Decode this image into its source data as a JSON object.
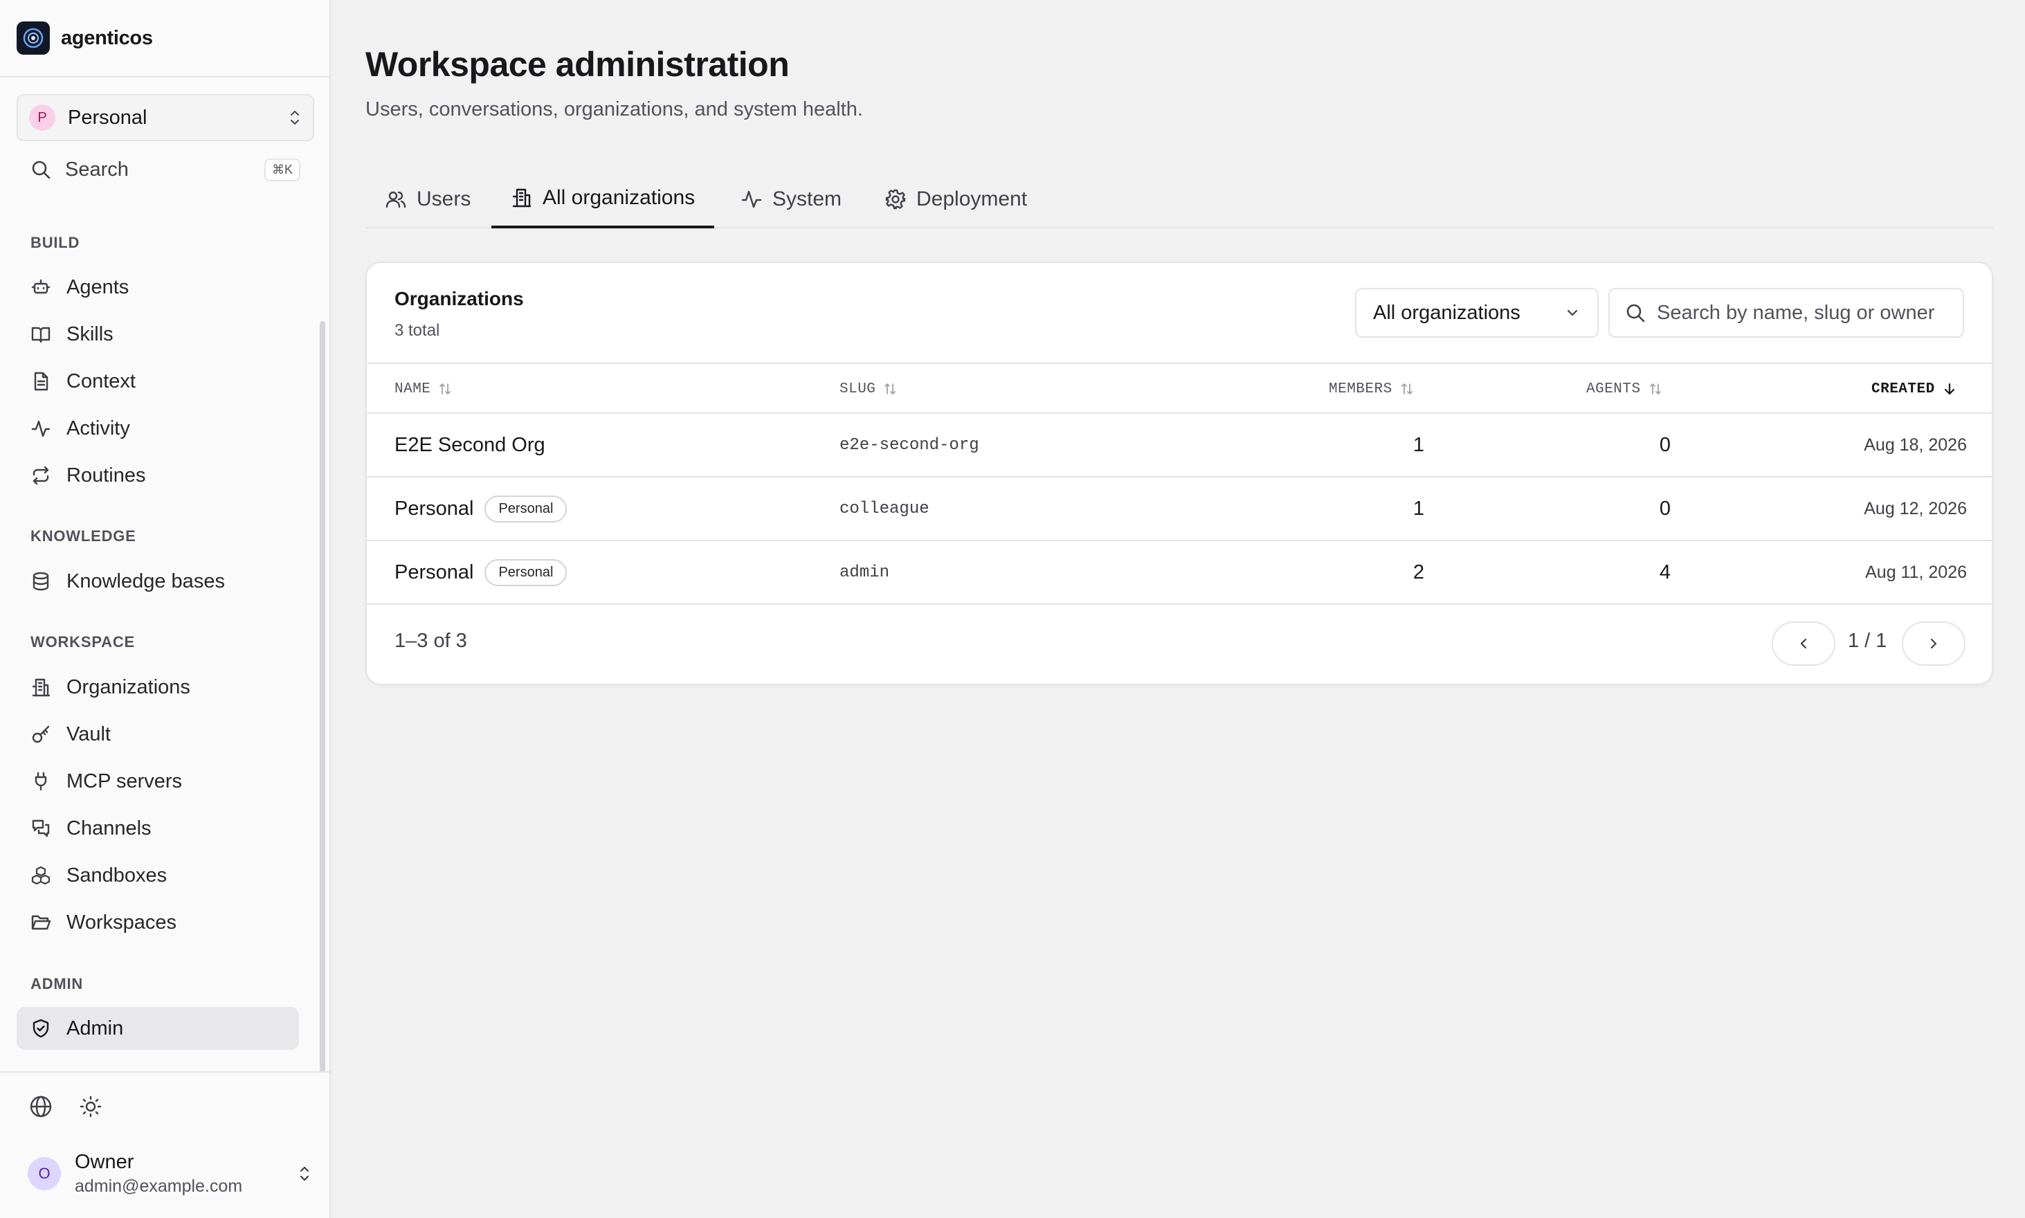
{
  "app": {
    "name": "agenticos"
  },
  "workspace": {
    "initial": "P",
    "name": "Personal"
  },
  "search": {
    "label": "Search",
    "shortcut": "⌘K"
  },
  "sidebar": {
    "sections": [
      {
        "title": "BUILD",
        "items": [
          {
            "label": "Agents",
            "icon": "robot-icon"
          },
          {
            "label": "Skills",
            "icon": "book-icon"
          },
          {
            "label": "Context",
            "icon": "document-icon"
          },
          {
            "label": "Activity",
            "icon": "activity-icon"
          },
          {
            "label": "Routines",
            "icon": "repeat-icon"
          }
        ]
      },
      {
        "title": "KNOWLEDGE",
        "items": [
          {
            "label": "Knowledge bases",
            "icon": "database-icon"
          }
        ]
      },
      {
        "title": "WORKSPACE",
        "items": [
          {
            "label": "Organizations",
            "icon": "building-icon"
          },
          {
            "label": "Vault",
            "icon": "key-icon"
          },
          {
            "label": "MCP servers",
            "icon": "plug-icon"
          },
          {
            "label": "Channels",
            "icon": "chat-icon"
          },
          {
            "label": "Sandboxes",
            "icon": "boxes-icon"
          },
          {
            "label": "Workspaces",
            "icon": "folder-icon"
          }
        ]
      },
      {
        "title": "ADMIN",
        "items": [
          {
            "label": "Admin",
            "icon": "shield-icon",
            "active": true
          }
        ]
      }
    ]
  },
  "user": {
    "initial": "O",
    "name": "Owner",
    "email": "admin@example.com"
  },
  "page": {
    "title": "Workspace administration",
    "subtitle": "Users, conversations, organizations, and system health."
  },
  "tabs": [
    {
      "label": "Users",
      "icon": "users-icon"
    },
    {
      "label": "All organizations",
      "icon": "building-icon",
      "active": true
    },
    {
      "label": "System",
      "icon": "activity-icon"
    },
    {
      "label": "Deployment",
      "icon": "gear-icon"
    }
  ],
  "orgs": {
    "title": "Organizations",
    "count": "3 total",
    "filter": "All organizations",
    "search_placeholder": "Search by name, slug or owner",
    "columns": {
      "name": "NAME",
      "slug": "SLUG",
      "members": "MEMBERS",
      "agents": "AGENTS",
      "created": "CREATED"
    },
    "rows": [
      {
        "name": "E2E Second Org",
        "badge": "",
        "slug": "e2e-second-org",
        "members": "1",
        "agents": "0",
        "created": "Aug 18, 2026"
      },
      {
        "name": "Personal",
        "badge": "Personal",
        "slug": "colleague",
        "members": "1",
        "agents": "0",
        "created": "Aug 12, 2026"
      },
      {
        "name": "Personal",
        "badge": "Personal",
        "slug": "admin",
        "members": "2",
        "agents": "4",
        "created": "Aug 11, 2026"
      }
    ],
    "range": "1–3 of 3",
    "page_indicator": "1 / 1"
  },
  "colors": {
    "accent": "#18181b",
    "border": "#e4e4e7",
    "muted": "#52525b"
  }
}
